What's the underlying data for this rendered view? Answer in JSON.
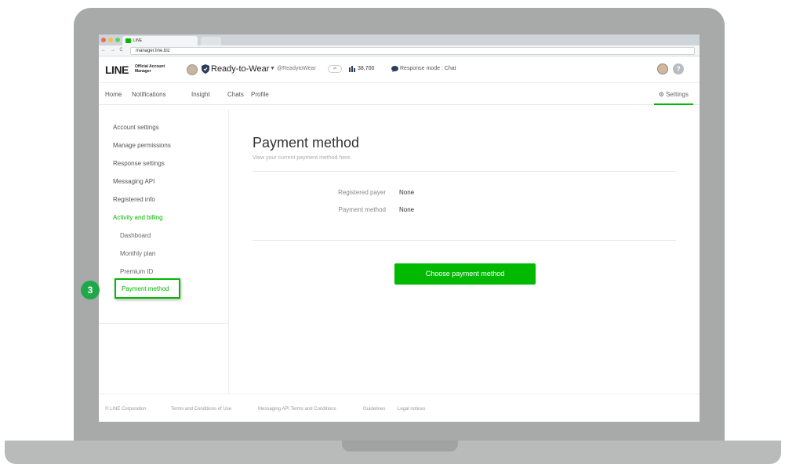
{
  "browser": {
    "tab_label": "LINE",
    "url": "manager.line.biz",
    "nav_arrows": "← → C"
  },
  "header": {
    "logo": "LINE",
    "logo_sub_line1": "Official Account",
    "logo_sub_line2": "Manager",
    "account_name": "Ready-to-Wear",
    "account_id": "@ReadytoWear",
    "tag": "⇄",
    "friends_count": "38,700",
    "response_mode": "Response mode : Chat",
    "help": "?"
  },
  "nav": {
    "items": [
      "Home",
      "Notifications",
      "Insight",
      "Chats",
      "Profile"
    ],
    "settings": "⚙ Settings"
  },
  "sidebar": {
    "items": [
      "Account settings",
      "Manage permissions",
      "Response settings",
      "Messaging API",
      "Registered info"
    ],
    "section": "Activity and billing",
    "sub_items": [
      "Dashboard",
      "Monthly plan",
      "Premium ID"
    ],
    "active": "Payment method"
  },
  "main": {
    "title": "Payment method",
    "subtitle": "View your current payment method here.",
    "rows": [
      {
        "label": "Registered payer",
        "value": "None"
      },
      {
        "label": "Payment method",
        "value": "None"
      }
    ],
    "cta": "Choose payment method"
  },
  "footer": {
    "links": [
      "© LINE Corporation",
      "Terms and Conditions of Use",
      "Messaging API Terms and Conditions",
      "Guidelines",
      "Legal notices"
    ]
  },
  "badge": "3",
  "colors": {
    "accent": "#00b900",
    "badge": "#1fa84a",
    "frame": "#a8aaaa"
  }
}
